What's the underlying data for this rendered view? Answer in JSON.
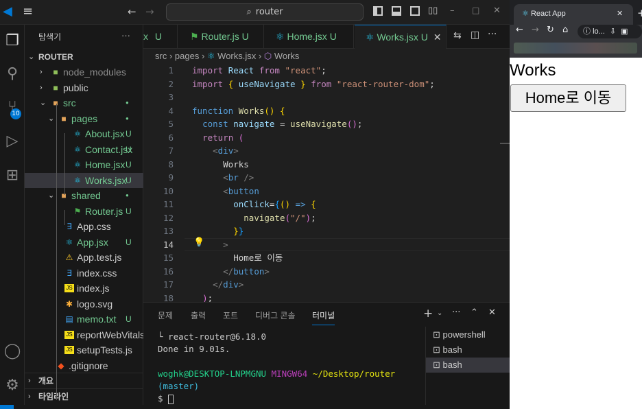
{
  "titlebar": {
    "search_text": "router",
    "back_icon": "←",
    "forward_icon": "→"
  },
  "explorer": {
    "title": "탐색기",
    "more": "···",
    "root": "ROUTER",
    "items": [
      {
        "name": "node_modules",
        "status": "",
        "depth": 1,
        "kind": "folder"
      },
      {
        "name": "public",
        "status": "",
        "depth": 1,
        "kind": "folder"
      },
      {
        "name": "src",
        "status": "●",
        "depth": 1,
        "kind": "folder-open"
      },
      {
        "name": "pages",
        "status": "●",
        "depth": 2,
        "kind": "folder-open"
      },
      {
        "name": "About.jsx",
        "status": "U",
        "depth": 3,
        "kind": "react"
      },
      {
        "name": "Contact.jsx",
        "status": "U",
        "depth": 3,
        "kind": "react"
      },
      {
        "name": "Home.jsx",
        "status": "U",
        "depth": 3,
        "kind": "react"
      },
      {
        "name": "Works.jsx",
        "status": "U",
        "depth": 3,
        "kind": "react"
      },
      {
        "name": "shared",
        "status": "●",
        "depth": 2,
        "kind": "folder-open"
      },
      {
        "name": "Router.js",
        "status": "U",
        "depth": 3,
        "kind": "router"
      },
      {
        "name": "App.css",
        "status": "",
        "depth": 2,
        "kind": "css"
      },
      {
        "name": "App.jsx",
        "status": "U",
        "depth": 2,
        "kind": "react"
      },
      {
        "name": "App.test.js",
        "status": "",
        "depth": 2,
        "kind": "test"
      },
      {
        "name": "index.css",
        "status": "",
        "depth": 2,
        "kind": "css"
      },
      {
        "name": "index.js",
        "status": "",
        "depth": 2,
        "kind": "js"
      },
      {
        "name": "logo.svg",
        "status": "",
        "depth": 2,
        "kind": "svg"
      },
      {
        "name": "memo.txt",
        "status": "U",
        "depth": 2,
        "kind": "txt"
      },
      {
        "name": "reportWebVitals.js",
        "status": "",
        "depth": 2,
        "kind": "js"
      },
      {
        "name": "setupTests.js",
        "status": "",
        "depth": 2,
        "kind": "js"
      },
      {
        "name": ".gitignore",
        "status": "",
        "depth": 1,
        "kind": "git"
      }
    ],
    "outline": "개요",
    "timeline": "타임라인",
    "source_control_badge": "10"
  },
  "tabs": [
    {
      "name": "x",
      "status": "U"
    },
    {
      "name": "Router.js",
      "status": "U"
    },
    {
      "name": "Home.jsx",
      "status": "U"
    },
    {
      "name": "Works.jsx",
      "status": "U"
    }
  ],
  "breadcrumb": {
    "p1": "src",
    "p2": "pages",
    "p3": "Works.jsx",
    "p4": "Works"
  },
  "editor": {
    "lines": [
      "1",
      "2",
      "3",
      "4",
      "5",
      "6",
      "7",
      "8",
      "9",
      "10",
      "11",
      "12",
      "13",
      "14",
      "15",
      "16",
      "17",
      "18"
    ],
    "current_line": "14"
  },
  "panel": {
    "tabs": [
      "문제",
      "출력",
      "포트",
      "디버그 콘솔",
      "터미널"
    ],
    "active_tab": "터미널",
    "terminal_lines": [
      "└ react-router@6.18.0",
      "Done in 9.01s.",
      "",
      "woghk@DESKTOP-LNPMGNU MINGW64 ~/Desktop/router",
      "(master)",
      "$ "
    ],
    "terminals": [
      "powershell",
      "bash",
      "bash"
    ]
  },
  "browser": {
    "tab_title": "React App",
    "address": "lo...",
    "page_heading": "Works",
    "page_button": "Home로 이동"
  },
  "colors": {
    "accent": "#0078d4",
    "untracked": "#73c991"
  }
}
